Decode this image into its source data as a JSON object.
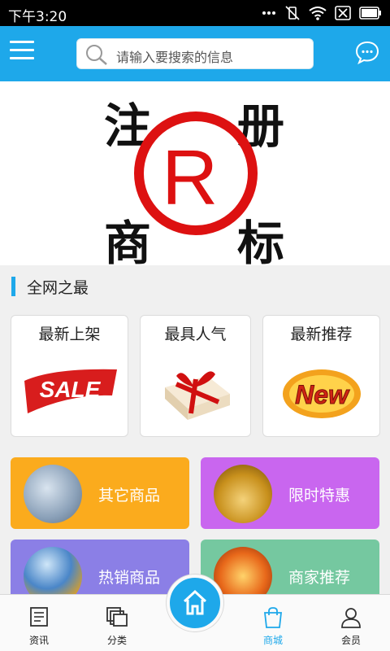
{
  "status_bar": {
    "time": "下午3:20",
    "icons": [
      "more-dots-icon",
      "vibrate-mute-icon",
      "wifi-icon",
      "sim-off-icon",
      "battery-icon"
    ]
  },
  "header": {
    "menu_icon": "hamburger-menu-icon",
    "search_placeholder": "请输入要搜索的信息",
    "chat_icon": "chat-bubble-icon",
    "accent_color": "#1ea8ea"
  },
  "banner": {
    "chars": [
      "注",
      "册",
      "商",
      "标"
    ],
    "symbol": "R",
    "symbol_color": "#dd1111"
  },
  "section": {
    "title": "全网之最"
  },
  "cards": [
    {
      "label": "最新上架",
      "art": "SALE"
    },
    {
      "label": "最具人气",
      "art": "gift-box"
    },
    {
      "label": "最新推荐",
      "art": "New"
    }
  ],
  "tiles": [
    {
      "label": "其它商品",
      "color": "#fbab1d"
    },
    {
      "label": "限时特惠",
      "color": "#c966ef"
    },
    {
      "label": "热销商品",
      "color": "#8b7fe6"
    },
    {
      "label": "商家推荐",
      "color": "#75c8a0"
    }
  ],
  "bottom_nav": {
    "items": [
      {
        "label": "资讯",
        "icon": "news-icon"
      },
      {
        "label": "分类",
        "icon": "category-icon"
      },
      {
        "label": "商城",
        "icon": "shopping-bag-icon",
        "active": true
      },
      {
        "label": "会员",
        "icon": "user-icon"
      }
    ],
    "home_icon": "home-icon"
  }
}
